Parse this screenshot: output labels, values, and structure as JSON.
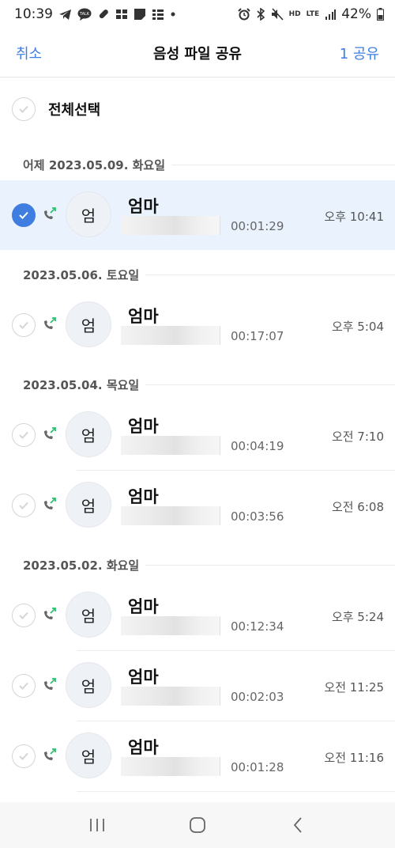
{
  "status_bar": {
    "time": "10:39",
    "left_icons": [
      "telegram-icon",
      "talk-icon",
      "pill-icon",
      "gallery-icon",
      "notes-icon",
      "grid-icon",
      "dot-icon"
    ],
    "right_icons": [
      "alarm-icon",
      "bluetooth-icon",
      "mute-icon",
      "hd-voice-icon",
      "lte-icon",
      "signal-icon"
    ],
    "talk_text": "TALK",
    "hd_text": "HD",
    "lte_text": "LTE",
    "battery": "42%"
  },
  "header": {
    "cancel_label": "취소",
    "title": "음성 파일 공유",
    "share_label": "1 공유"
  },
  "select_all_label": "전체선택",
  "groups": [
    {
      "date": "어제 2023.05.09. 화요일"
    },
    {
      "date": "2023.05.06. 토요일"
    },
    {
      "date": "2023.05.04. 목요일"
    },
    {
      "date": "2023.05.02. 화요일"
    }
  ],
  "records": [
    {
      "avatar": "엄",
      "name": "엄마",
      "duration": "00:01:29",
      "time": "오후 10:41",
      "selected": true
    },
    {
      "avatar": "엄",
      "name": "엄마",
      "duration": "00:17:07",
      "time": "오후 5:04",
      "selected": false
    },
    {
      "avatar": "엄",
      "name": "엄마",
      "duration": "00:04:19",
      "time": "오전 7:10",
      "selected": false
    },
    {
      "avatar": "엄",
      "name": "엄마",
      "duration": "00:03:56",
      "time": "오전 6:08",
      "selected": false
    },
    {
      "avatar": "엄",
      "name": "엄마",
      "duration": "00:12:34",
      "time": "오후 5:24",
      "selected": false
    },
    {
      "avatar": "엄",
      "name": "엄마",
      "duration": "00:02:03",
      "time": "오전 11:25",
      "selected": false
    },
    {
      "avatar": "엄",
      "name": "엄마",
      "duration": "00:01:28",
      "time": "오전 11:16",
      "selected": false
    }
  ],
  "colors": {
    "accent": "#3f7de0",
    "selected_row": "#eaf3fd",
    "outgoing_arrow": "#2fbf71"
  },
  "nav": {
    "recents_icon": "recents-icon",
    "home_icon": "home-icon",
    "back_icon": "back-icon"
  }
}
